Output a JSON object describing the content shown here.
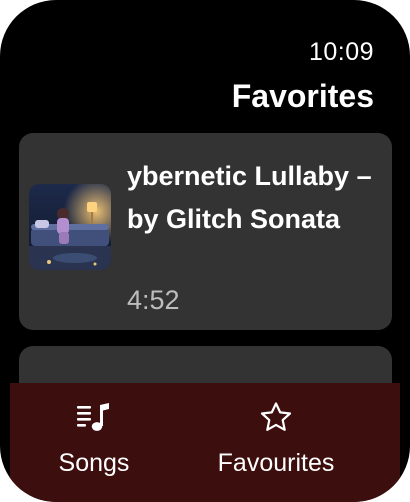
{
  "status": {
    "time": "10:09"
  },
  "header": {
    "title": "Favorites"
  },
  "favorites": {
    "items": [
      {
        "title": "ybernetic Lullaby – by Glitch Sonata",
        "duration": "4:52",
        "artwork": "album-art-girl-on-bed-at-night"
      }
    ]
  },
  "bottom_nav": {
    "songs_label": "Songs",
    "songs_icon": "music-list-icon",
    "favourites_label": "Favourites",
    "favourites_icon": "star-outline-icon"
  },
  "colors": {
    "background": "#000000",
    "card": "#333333",
    "bottom_bar": "#3d0e0e",
    "text_primary": "#ffffff",
    "text_secondary": "#bdbdbd"
  }
}
